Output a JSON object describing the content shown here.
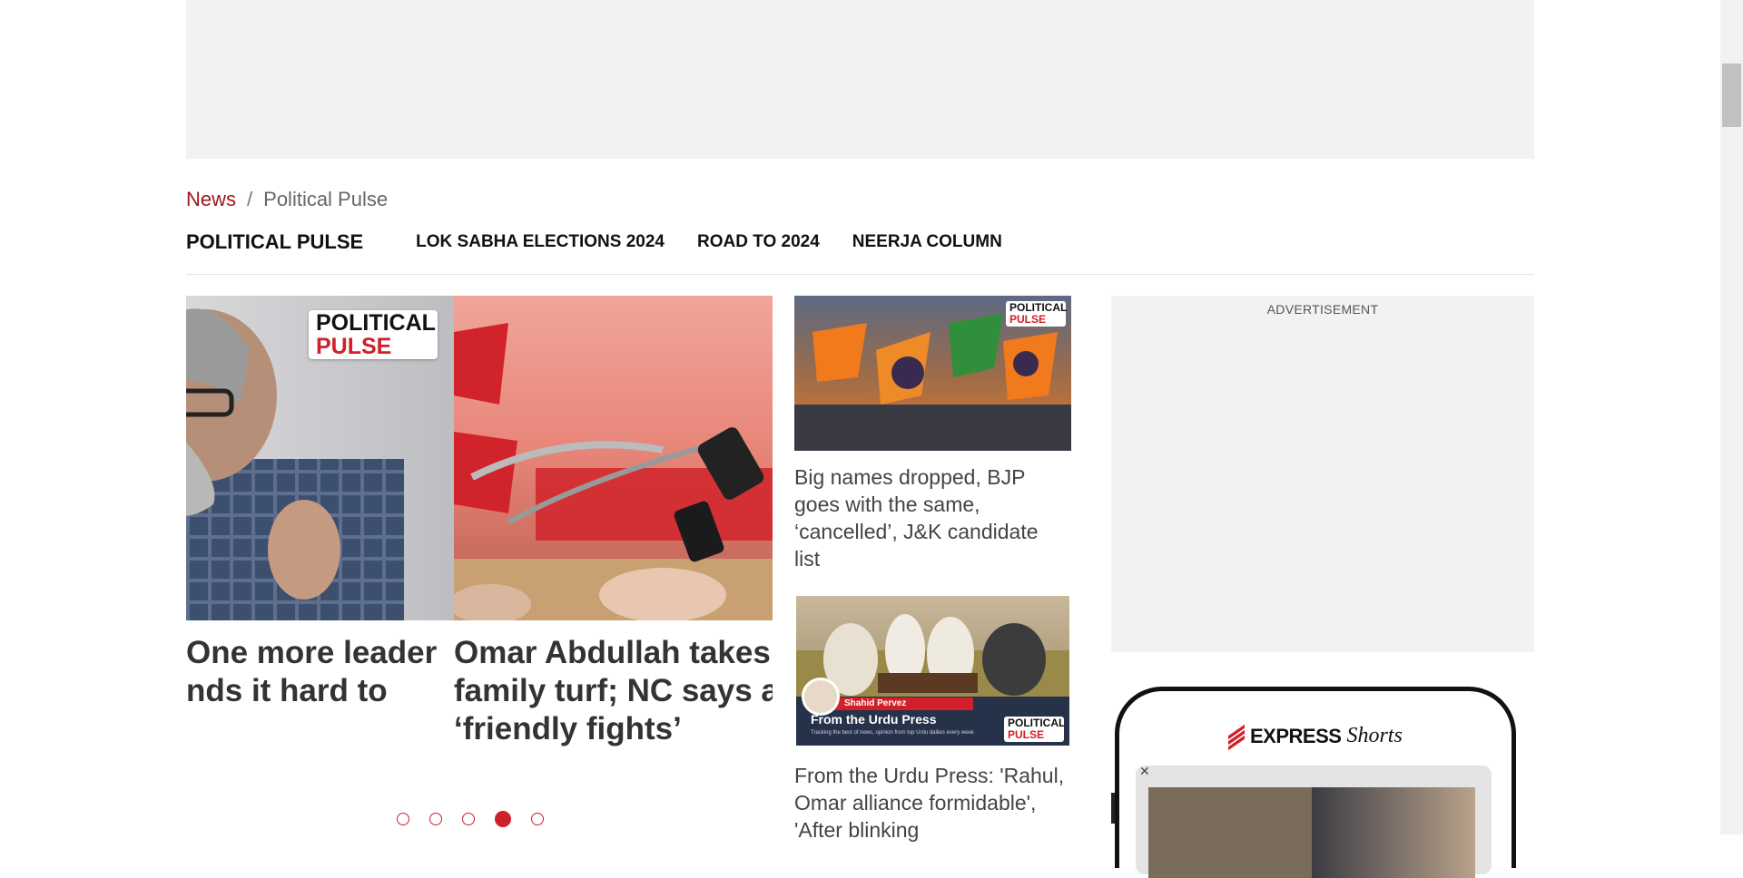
{
  "breadcrumb": {
    "home": "News",
    "separator": "/",
    "current": "Political Pulse"
  },
  "subnav": {
    "brand": "POLITICAL PULSE",
    "links": [
      "LOK SABHA ELECTIONS 2024",
      "ROAD TO 2024",
      "NEERJA COLUMN"
    ]
  },
  "badge": {
    "line1": "POLITICAL",
    "line2": "PULSE"
  },
  "carousel": {
    "slides": [
      {
        "title_line1": "One more leader",
        "title_line2": "nds it hard to"
      },
      {
        "title_line1": "Omar Abdullah takes t",
        "title_line2": "family turf; NC says al",
        "title_line3": "‘friendly fights’"
      }
    ],
    "dots_total": 5,
    "active_dot": 4
  },
  "stories": [
    {
      "title": "Big names dropped, BJP goes with the same, ‘cancelled’, J&K candidate list"
    },
    {
      "title": "From the Urdu Press: 'Rahul, Omar alliance formidable', 'After blinking",
      "thumb_name": "Shahid Pervez",
      "thumb_title": "From the Urdu Press",
      "thumb_subtitle": "Tracking the best of news, opinion from top Urdu dailies every week"
    }
  ],
  "advertisement_label": "ADVERTISEMENT",
  "express_shorts": {
    "brand": "EXPRESS",
    "product": "Shorts",
    "close": "✕"
  },
  "colors": {
    "accent": "#d0202a",
    "breadcrumb_link": "#a1161e",
    "ad_bg": "#f2f2f2"
  }
}
